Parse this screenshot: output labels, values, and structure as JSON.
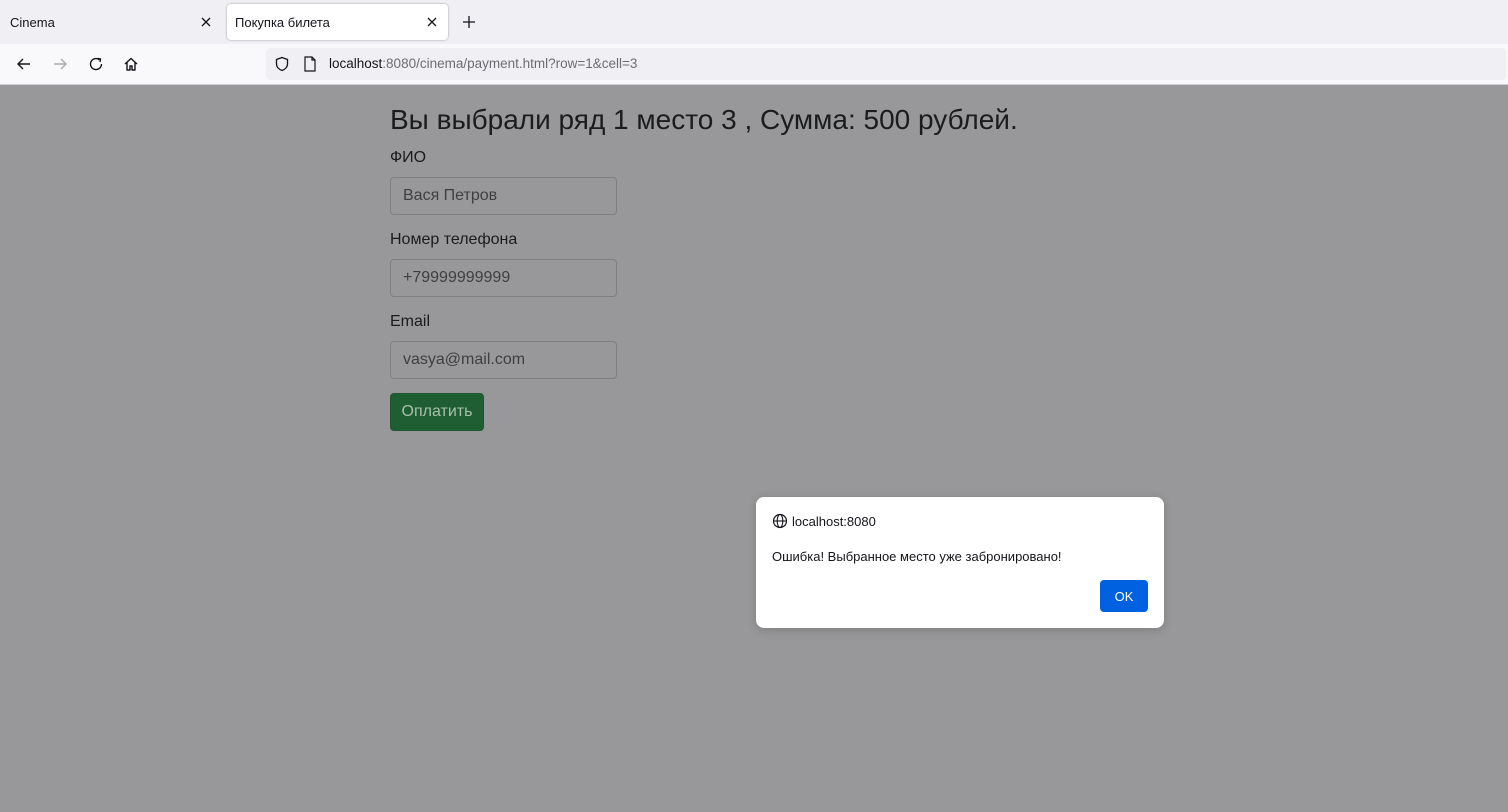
{
  "browser": {
    "tabs": [
      {
        "label": "Cinema",
        "active": false
      },
      {
        "label": "Покупка билета",
        "active": true
      }
    ],
    "url_host": "localhost",
    "url_rest": ":8080/cinema/payment.html?row=1&cell=3",
    "icons": {
      "back": "arrow-left-icon",
      "forward": "arrow-right-icon",
      "reload": "reload-icon",
      "home": "home-icon",
      "shield": "shield-icon",
      "page": "page-icon",
      "new_tab": "plus-icon",
      "close": "close-icon"
    }
  },
  "page": {
    "heading": "Вы выбрали ряд 1 место 3 , Сумма: 500 рублей.",
    "fields": [
      {
        "label": "ФИО",
        "value": "Вася Петров"
      },
      {
        "label": "Номер телефона",
        "value": "+79999999999"
      },
      {
        "label": "Email",
        "value": "vasya@mail.com"
      }
    ],
    "submit_label": "Оплатить"
  },
  "dialog": {
    "origin": "localhost:8080",
    "message": "Ошибка! Выбранное место уже забронировано!",
    "ok_label": "OK",
    "ok_color": "#0061e0"
  },
  "colors": {
    "overlay_bg": "#98989a",
    "pay_button": "#1f5d33"
  }
}
